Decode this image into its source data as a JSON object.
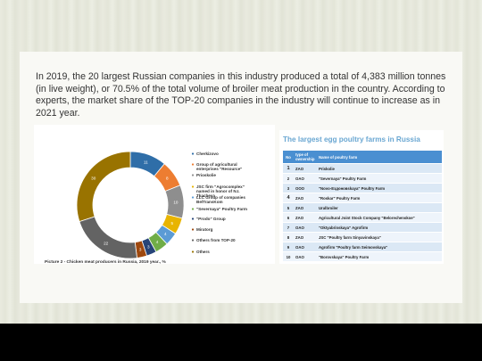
{
  "intro_text": "In 2019, the 20 largest Russian companies in this industry produced a total of 4,383 million tonnes (in live weight), or 70.5% of the total volume of broiler meat production in the country. According to experts, the market share of the TOP-20 companies in the industry will continue to increase as in 2021 year.",
  "chart_data": {
    "type": "pie",
    "title": "Picture 2 - Chicken meat producers in Russia, 2019 year., %",
    "categories": [
      "Cherkizovo",
      "Group of agricultural enterprises \"Resource\"",
      "Prioskolie",
      "JSC firm \"Agrocomplex\" named in honor of N.I. Tkacheva",
      "LLC Group of companies BelTransKom",
      "\"Severnaya\" Poultry Farm",
      "\"Prodo\" Group",
      "Miratorg",
      "Others from TOP-20",
      "Others"
    ],
    "values": [
      11,
      8,
      10,
      5,
      4,
      4,
      3,
      3,
      22,
      30
    ],
    "data_labels": [
      "11",
      "8",
      "10",
      "5",
      "4",
      "4",
      "3",
      "3",
      "22",
      "30"
    ],
    "colors": [
      "#2f6ea8",
      "#ed7d31",
      "#8e8e8e",
      "#e8b400",
      "#5b9bd5",
      "#70ad47",
      "#264478",
      "#9e480e",
      "#636363",
      "#997300"
    ]
  },
  "table": {
    "title": "The largest egg poultry farms in Russia",
    "headers": [
      "No",
      "type of ownership",
      "Name of poultry farm"
    ],
    "rows": [
      [
        "1",
        "ZAO",
        "Priskolie"
      ],
      [
        "2",
        "OAO",
        "\"Severnaya\" Poultry Farm"
      ],
      [
        "3",
        "OOO",
        "\"Novo-Ездоновskaya\" Poultry Farm"
      ],
      [
        "4",
        "ZAO",
        "\"Roskar\" Poultry Farm"
      ],
      [
        "5",
        "ZAO",
        "Uralbroiler"
      ],
      [
        "6",
        "ZAO",
        "Agricultural Joint Stock Company \"Belorechenskoe\""
      ],
      [
        "7",
        "OAO",
        "\"Oktyabrinskaya\" Agrofirm"
      ],
      [
        "8",
        "ZAO",
        "JSC \"Poultry farm Sinyavinskaya\""
      ],
      [
        "9",
        "OAO",
        "Agrofirm \"Poultry farm Seimovskaya\""
      ],
      [
        "10",
        "OAO",
        "\"Borovskaya\" Poultry Farm"
      ]
    ]
  }
}
